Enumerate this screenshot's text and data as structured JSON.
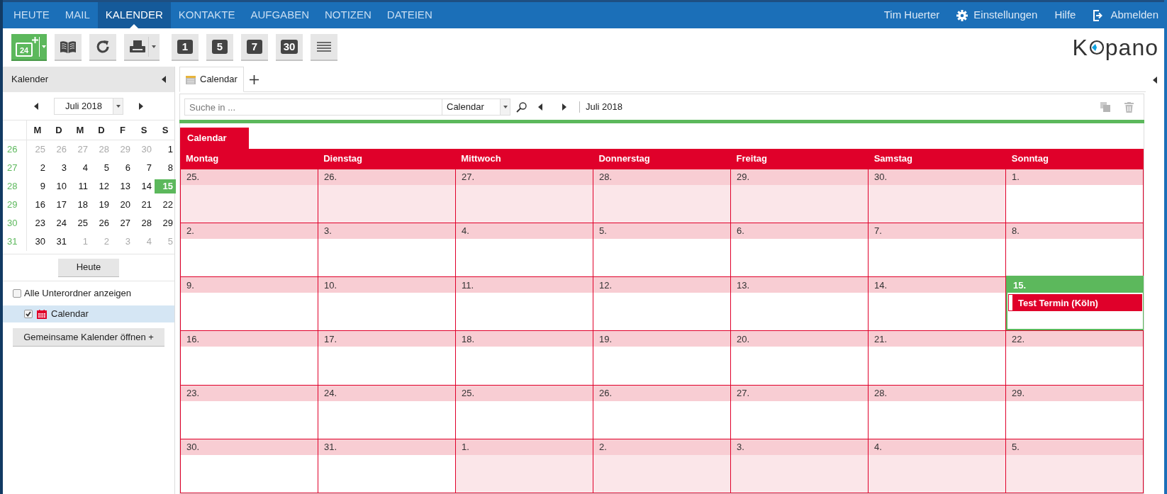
{
  "nav": {
    "items": [
      {
        "label": "HEUTE",
        "selected": false
      },
      {
        "label": "MAIL",
        "selected": false
      },
      {
        "label": "KALENDER",
        "selected": true
      },
      {
        "label": "KONTAKTE",
        "selected": false
      },
      {
        "label": "AUFGABEN",
        "selected": false
      },
      {
        "label": "NOTIZEN",
        "selected": false
      },
      {
        "label": "DATEIEN",
        "selected": false
      }
    ],
    "user": "Tim Huerter",
    "settings": "Einstellungen",
    "help": "Hilfe",
    "logout": "Abmelden"
  },
  "toolbar": {
    "new_label": "24",
    "view_buttons": [
      "1",
      "5",
      "7",
      "30"
    ]
  },
  "logo": {
    "before": "K",
    "after": "pano"
  },
  "sidebar": {
    "title": "Kalender",
    "month": "Juli 2018",
    "weekdays": [
      "M",
      "D",
      "M",
      "D",
      "F",
      "S",
      "S"
    ],
    "weeks": [
      {
        "number": "26",
        "days": [
          {
            "day": "25",
            "other_month": true,
            "selected": false
          },
          {
            "day": "26",
            "other_month": true,
            "selected": false
          },
          {
            "day": "27",
            "other_month": true,
            "selected": false
          },
          {
            "day": "28",
            "other_month": true,
            "selected": false
          },
          {
            "day": "29",
            "other_month": true,
            "selected": false
          },
          {
            "day": "30",
            "other_month": true,
            "selected": false
          },
          {
            "day": "1",
            "other_month": false,
            "selected": false
          }
        ]
      },
      {
        "number": "27",
        "days": [
          {
            "day": "2",
            "other_month": false,
            "selected": false
          },
          {
            "day": "3",
            "other_month": false,
            "selected": false
          },
          {
            "day": "4",
            "other_month": false,
            "selected": false
          },
          {
            "day": "5",
            "other_month": false,
            "selected": false
          },
          {
            "day": "6",
            "other_month": false,
            "selected": false
          },
          {
            "day": "7",
            "other_month": false,
            "selected": false
          },
          {
            "day": "8",
            "other_month": false,
            "selected": false
          }
        ]
      },
      {
        "number": "28",
        "days": [
          {
            "day": "9",
            "other_month": false,
            "selected": false
          },
          {
            "day": "10",
            "other_month": false,
            "selected": false
          },
          {
            "day": "11",
            "other_month": false,
            "selected": false
          },
          {
            "day": "12",
            "other_month": false,
            "selected": false
          },
          {
            "day": "13",
            "other_month": false,
            "selected": false
          },
          {
            "day": "14",
            "other_month": false,
            "selected": false
          },
          {
            "day": "15",
            "other_month": false,
            "selected": true
          }
        ]
      },
      {
        "number": "29",
        "days": [
          {
            "day": "16",
            "other_month": false,
            "selected": false
          },
          {
            "day": "17",
            "other_month": false,
            "selected": false
          },
          {
            "day": "18",
            "other_month": false,
            "selected": false
          },
          {
            "day": "19",
            "other_month": false,
            "selected": false
          },
          {
            "day": "20",
            "other_month": false,
            "selected": false
          },
          {
            "day": "21",
            "other_month": false,
            "selected": false
          },
          {
            "day": "22",
            "other_month": false,
            "selected": false
          }
        ]
      },
      {
        "number": "30",
        "days": [
          {
            "day": "23",
            "other_month": false,
            "selected": false
          },
          {
            "day": "24",
            "other_month": false,
            "selected": false
          },
          {
            "day": "25",
            "other_month": false,
            "selected": false
          },
          {
            "day": "26",
            "other_month": false,
            "selected": false
          },
          {
            "day": "27",
            "other_month": false,
            "selected": false
          },
          {
            "day": "28",
            "other_month": false,
            "selected": false
          },
          {
            "day": "29",
            "other_month": false,
            "selected": false
          }
        ]
      },
      {
        "number": "31",
        "days": [
          {
            "day": "30",
            "other_month": false,
            "selected": false
          },
          {
            "day": "31",
            "other_month": false,
            "selected": false
          },
          {
            "day": "1",
            "other_month": true,
            "selected": false
          },
          {
            "day": "2",
            "other_month": true,
            "selected": false
          },
          {
            "day": "3",
            "other_month": true,
            "selected": false
          },
          {
            "day": "4",
            "other_month": true,
            "selected": false
          },
          {
            "day": "5",
            "other_month": true,
            "selected": false
          }
        ]
      }
    ],
    "today_button": "Heute",
    "show_subfolders": {
      "label": "Alle Unterordner anzeigen",
      "checked": false
    },
    "folders": [
      {
        "label": "Calendar",
        "checked": true,
        "selected": true
      }
    ],
    "open_shared": "Gemeinsame Kalender öffnen +"
  },
  "main": {
    "tabs": [
      {
        "label": "Calendar",
        "selected": true
      }
    ],
    "search_placeholder": "Suche in ...",
    "search_scope": "Calendar",
    "period": "Juli 2018",
    "calendar_label": "Calendar",
    "day_names": [
      "Montag",
      "Dienstag",
      "Mittwoch",
      "Donnerstag",
      "Freitag",
      "Samstag",
      "Sonntag"
    ],
    "weeks": [
      {
        "days": [
          {
            "date": "25.",
            "other_month": true,
            "today": false
          },
          {
            "date": "26.",
            "other_month": true,
            "today": false
          },
          {
            "date": "27.",
            "other_month": true,
            "today": false
          },
          {
            "date": "28.",
            "other_month": true,
            "today": false
          },
          {
            "date": "29.",
            "other_month": true,
            "today": false
          },
          {
            "date": "30.",
            "other_month": true,
            "today": false
          },
          {
            "date": "1.",
            "other_month": false,
            "today": false
          }
        ]
      },
      {
        "days": [
          {
            "date": "2.",
            "other_month": false,
            "today": false
          },
          {
            "date": "3.",
            "other_month": false,
            "today": false
          },
          {
            "date": "4.",
            "other_month": false,
            "today": false
          },
          {
            "date": "5.",
            "other_month": false,
            "today": false
          },
          {
            "date": "6.",
            "other_month": false,
            "today": false
          },
          {
            "date": "7.",
            "other_month": false,
            "today": false
          },
          {
            "date": "8.",
            "other_month": false,
            "today": false
          }
        ]
      },
      {
        "days": [
          {
            "date": "9.",
            "other_month": false,
            "today": false
          },
          {
            "date": "10.",
            "other_month": false,
            "today": false
          },
          {
            "date": "11.",
            "other_month": false,
            "today": false
          },
          {
            "date": "12.",
            "other_month": false,
            "today": false
          },
          {
            "date": "13.",
            "other_month": false,
            "today": false
          },
          {
            "date": "14.",
            "other_month": false,
            "today": false
          },
          {
            "date": "15.",
            "other_month": false,
            "today": true,
            "events": [
              {
                "title": "Test Termin (Köln)"
              }
            ]
          }
        ]
      },
      {
        "days": [
          {
            "date": "16.",
            "other_month": false,
            "today": false
          },
          {
            "date": "17.",
            "other_month": false,
            "today": false
          },
          {
            "date": "18.",
            "other_month": false,
            "today": false
          },
          {
            "date": "19.",
            "other_month": false,
            "today": false
          },
          {
            "date": "20.",
            "other_month": false,
            "today": false
          },
          {
            "date": "21.",
            "other_month": false,
            "today": false
          },
          {
            "date": "22.",
            "other_month": false,
            "today": false
          }
        ]
      },
      {
        "days": [
          {
            "date": "23.",
            "other_month": false,
            "today": false
          },
          {
            "date": "24.",
            "other_month": false,
            "today": false
          },
          {
            "date": "25.",
            "other_month": false,
            "today": false
          },
          {
            "date": "26.",
            "other_month": false,
            "today": false
          },
          {
            "date": "27.",
            "other_month": false,
            "today": false
          },
          {
            "date": "28.",
            "other_month": false,
            "today": false
          },
          {
            "date": "29.",
            "other_month": false,
            "today": false
          }
        ]
      },
      {
        "days": [
          {
            "date": "30.",
            "other_month": false,
            "today": false
          },
          {
            "date": "31.",
            "other_month": false,
            "today": false
          },
          {
            "date": "1.",
            "other_month": true,
            "today": false
          },
          {
            "date": "2.",
            "other_month": true,
            "today": false
          },
          {
            "date": "3.",
            "other_month": true,
            "today": false
          },
          {
            "date": "4.",
            "other_month": true,
            "today": false
          },
          {
            "date": "5.",
            "other_month": true,
            "today": false
          }
        ]
      }
    ]
  }
}
